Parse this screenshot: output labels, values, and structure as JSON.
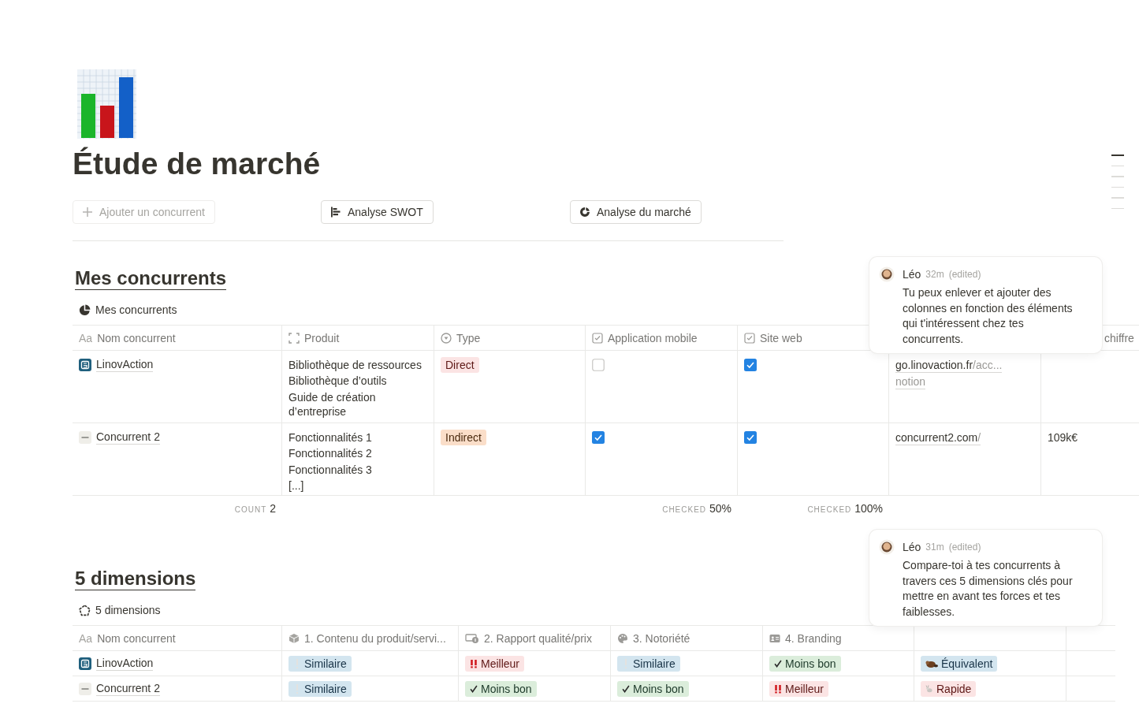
{
  "page": {
    "title": "Étude de marché"
  },
  "actions": [
    {
      "label": "Ajouter un concurrent",
      "kind": "add",
      "disabled": true
    },
    {
      "label": "Analyse SWOT",
      "kind": "swot",
      "disabled": false
    },
    {
      "label": "Analyse du marché",
      "kind": "market",
      "disabled": false
    }
  ],
  "competitors": {
    "heading": "Mes concurrents",
    "view_title": "Mes concurrents",
    "comment": {
      "author": "Léo",
      "time": "32m",
      "note": "(edited)",
      "text": "Tu peux enlever et ajouter des colonnes en fonction des éléments qui t'intéressent chez tes concurrents."
    },
    "columns": [
      {
        "kind": "title",
        "glyph": "Aa",
        "label": "Nom concurrent",
        "calc": {
          "label": "COUNT",
          "value": "2"
        }
      },
      {
        "kind": "files",
        "label": "Produit"
      },
      {
        "kind": "select",
        "label": "Type"
      },
      {
        "kind": "checkbox",
        "label": "Application mobile",
        "calc": {
          "label": "CHECKED",
          "value": "50%"
        }
      },
      {
        "kind": "checkbox",
        "label": "Site web",
        "calc": {
          "label": "CHECKED",
          "value": "100%"
        }
      },
      {
        "kind": "url"
      },
      {
        "kind": "number",
        "label": "chiffre"
      }
    ],
    "rows": [
      {
        "name": "LinovAction",
        "kind": "logo",
        "products": [
          "Bibliothèque de ressources",
          "Bibliothèque d’outils",
          "Guide de création d’entreprise"
        ],
        "type": {
          "label": "Direct",
          "color": "#fbe4e4"
        },
        "mobile": false,
        "website": true,
        "links": [
          {
            "parts": [
              {
                "text": "go.linovaction.fr",
                "muted": false
              },
              {
                "text": "/acc...",
                "muted": true
              }
            ]
          },
          {
            "parts": [
              {
                "text": "notion",
                "muted": true
              }
            ]
          }
        ]
      },
      {
        "name": "Concurrent 2",
        "kind": "blank",
        "products": [
          "Fonctionnalités 1",
          "Fonctionnalités 2",
          "Fonctionnalités 3",
          "[...]"
        ],
        "type": {
          "label": "Indirect",
          "color": "#fadec9"
        },
        "mobile": true,
        "website": true,
        "links": [
          {
            "parts": [
              {
                "text": "concurrent2.com",
                "muted": false
              },
              {
                "text": "/",
                "muted": true
              }
            ]
          }
        ],
        "revenue": "109k€"
      }
    ]
  },
  "dimensions": {
    "heading": "5 dimensions",
    "view_title": "5 dimensions",
    "comment": {
      "author": "Léo",
      "time": "31m",
      "note": "(edited)",
      "text": "Compare-toi à tes concurrents à travers ces 5 dimensions clés pour mettre en avant tes forces et tes faiblesses."
    },
    "columns": [
      {
        "kind": "title",
        "glyph": "Aa",
        "label": "Nom concurrent"
      },
      {
        "kind": "box",
        "label": "1. Contenu du produit/servi..."
      },
      {
        "kind": "money",
        "label": "2. Rapport qualité/prix"
      },
      {
        "kind": "palette",
        "label": "3. Notoriété"
      },
      {
        "kind": "idcard",
        "label": "4. Branding"
      },
      {
        "kind": "hidden"
      },
      {
        "kind": "blank"
      }
    ],
    "rows": [
      {
        "name": "LinovAction",
        "kind": "logo",
        "tags": [
          {
            "label": "Similaire",
            "kind": "similar",
            "color": "#d3e5ef"
          },
          {
            "label": "Meilleur",
            "kind": "better",
            "color": "#fbe4e4"
          },
          {
            "label": "Similaire",
            "kind": "similar",
            "color": "#d3e5ef"
          },
          {
            "label": "Moins bon",
            "kind": "worse",
            "color": "#dbeddb"
          },
          {
            "label": "Équivalent",
            "kind": "equivalent",
            "color": "#d3e5ef"
          }
        ]
      },
      {
        "name": "Concurrent 2",
        "kind": "blank",
        "tags": [
          {
            "label": "Similaire",
            "kind": "similar",
            "color": "#d3e5ef"
          },
          {
            "label": "Moins bon",
            "kind": "worse",
            "color": "#dbeddb"
          },
          {
            "label": "Moins bon",
            "kind": "worse",
            "color": "#dbeddb"
          },
          {
            "label": "Meilleur",
            "kind": "better",
            "color": "#fbe4e4"
          },
          {
            "label": "Rapide",
            "kind": "fast",
            "color": "#fbe4e4"
          }
        ]
      }
    ]
  }
}
